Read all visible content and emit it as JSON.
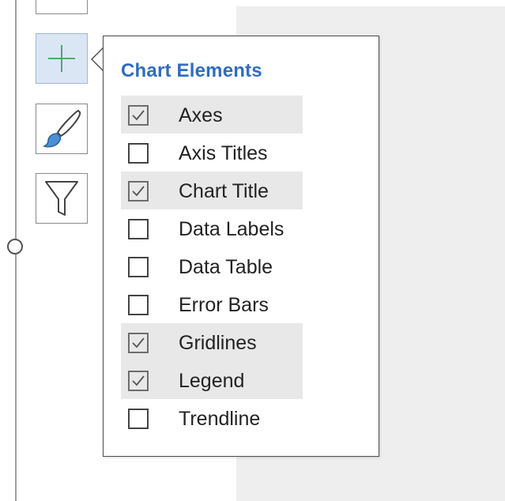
{
  "sidebar": {
    "buttons": [
      {
        "icon": "plus-icon",
        "tooltip": "",
        "active": true
      },
      {
        "icon": "paintbrush-icon",
        "active": false
      },
      {
        "icon": "funnel-icon",
        "active": false
      }
    ]
  },
  "popup": {
    "title": "Chart Elements",
    "items": [
      {
        "label": "Axes",
        "checked": true
      },
      {
        "label": "Axis Titles",
        "checked": false
      },
      {
        "label": "Chart Title",
        "checked": true
      },
      {
        "label": "Data Labels",
        "checked": false
      },
      {
        "label": "Data Table",
        "checked": false
      },
      {
        "label": "Error Bars",
        "checked": false
      },
      {
        "label": "Gridlines",
        "checked": true
      },
      {
        "label": "Legend",
        "checked": true
      },
      {
        "label": "Trendline",
        "checked": false
      }
    ]
  },
  "colors": {
    "title": "#2f6dbd",
    "plus": "#3aa655",
    "brush_tip": "#4b8fd6",
    "active_button": "#dbe6f4",
    "checked_row": "#e8e8e8"
  }
}
